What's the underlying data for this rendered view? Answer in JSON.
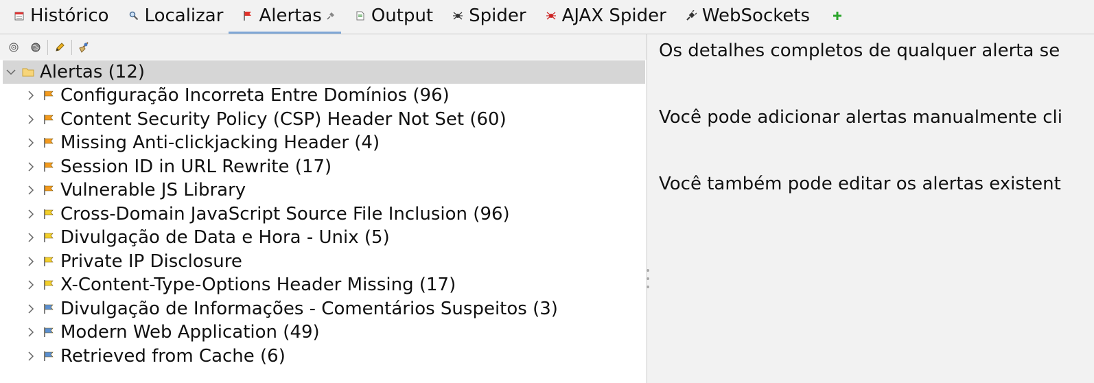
{
  "tabs": [
    {
      "label": "Histórico",
      "icon": "calendar-icon"
    },
    {
      "label": "Localizar",
      "icon": "magnifier-icon"
    },
    {
      "label": "Alertas",
      "icon": "red-flag-icon",
      "active": true,
      "pinned": true
    },
    {
      "label": "Output",
      "icon": "document-icon"
    },
    {
      "label": "Spider",
      "icon": "spider-icon"
    },
    {
      "label": "AJAX Spider",
      "icon": "red-spider-icon"
    },
    {
      "label": "WebSockets",
      "icon": "plug-icon"
    }
  ],
  "add_tab_icon": "plus-icon",
  "toolbar": {
    "icons": [
      "target-icon",
      "globe-icon",
      "pencil-icon",
      "broom-icon"
    ]
  },
  "tree": {
    "root_label": "Alertas (12)",
    "items": [
      {
        "label": "Configuração Incorreta Entre Domínios (96)",
        "risk": "medium"
      },
      {
        "label": "Content Security Policy (CSP) Header Not Set (60)",
        "risk": "medium"
      },
      {
        "label": "Missing Anti-clickjacking Header (4)",
        "risk": "medium"
      },
      {
        "label": "Session ID in URL Rewrite (17)",
        "risk": "medium"
      },
      {
        "label": "Vulnerable JS Library",
        "risk": "medium"
      },
      {
        "label": "Cross-Domain JavaScript Source File Inclusion (96)",
        "risk": "low"
      },
      {
        "label": "Divulgação de Data e Hora - Unix (5)",
        "risk": "low"
      },
      {
        "label": "Private IP Disclosure",
        "risk": "low"
      },
      {
        "label": "X-Content-Type-Options Header Missing (17)",
        "risk": "low"
      },
      {
        "label": "Divulgação de Informações - Comentários Suspeitos (3)",
        "risk": "info"
      },
      {
        "label": "Modern Web Application (49)",
        "risk": "info"
      },
      {
        "label": "Retrieved from Cache (6)",
        "risk": "info"
      }
    ]
  },
  "details": {
    "line1": "Os detalhes completos de qualquer alerta se",
    "line2": "Você pode adicionar alertas manualmente cli",
    "line3": "Você também pode editar os alertas existent"
  },
  "colors": {
    "medium_flag": "#f39a1e",
    "low_flag": "#f2cf2b",
    "info_flag": "#5b8fd0",
    "high_flag": "#e0332b",
    "active_tab_underline": "#7fa7d6"
  }
}
